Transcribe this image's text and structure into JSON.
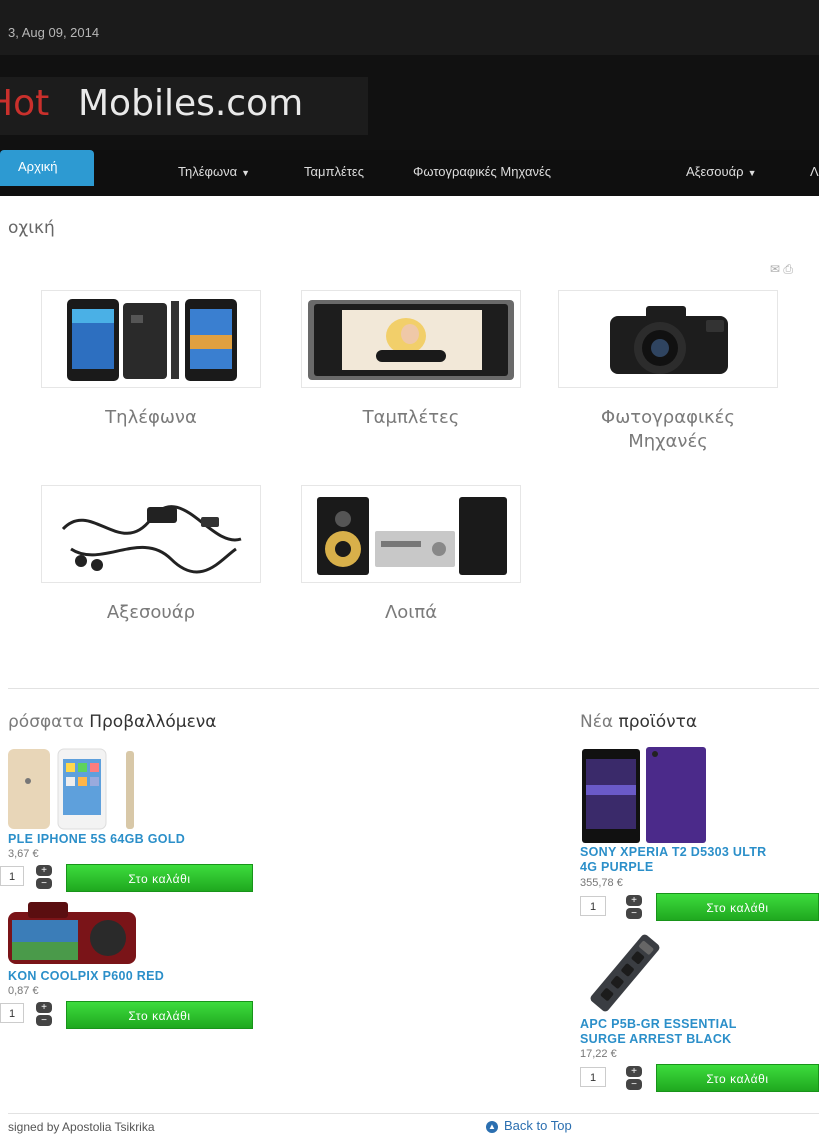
{
  "topbar": {
    "date": "3, Aug 09, 2014"
  },
  "logo": {
    "hot": "Hot",
    "main": "Mobiles.com"
  },
  "nav": [
    {
      "label": "Αρχική",
      "active": true
    },
    {
      "label": "Τηλέφωνα",
      "dropdown": true
    },
    {
      "label": "Ταμπλέτες"
    },
    {
      "label": "Φωτογραφικές Μηχανές"
    },
    {
      "label": "Αξεσουάρ",
      "dropdown": true
    },
    {
      "label": "Λ"
    }
  ],
  "breadcrumb": "οχική",
  "categories": [
    {
      "label": "Τηλέφωνα",
      "icon": "phones-image"
    },
    {
      "label": "Ταμπλέτες",
      "icon": "tablet-image"
    },
    {
      "label": "Φωτογραφικές Μηχανές",
      "label_line1": "Φωτογραφικές",
      "label_line2": "Μηχανές",
      "icon": "camera-image"
    },
    {
      "label": "Αξεσουάρ",
      "icon": "accessories-image"
    },
    {
      "label": "Λοιπά",
      "icon": "speakers-image"
    }
  ],
  "recent": {
    "title_a": "ρόσφατα",
    "title_b": "Προβαλλόμενα",
    "products": [
      {
        "name": "PLE IPHONE 5S 64GB GOLD",
        "price": "3,67 €",
        "qty": "1",
        "button": "Στο καλάθι"
      },
      {
        "name": "KON COOLPIX P600 RED",
        "price": "0,87 €",
        "qty": "1",
        "button": "Στο καλάθι"
      }
    ]
  },
  "new_products": {
    "title_a": "Νέα",
    "title_b": "προϊόντα",
    "products": [
      {
        "name_line1": "SONY XPERIA T2 D5303 ULTR",
        "name_line2": "4G PURPLE",
        "price": "355,78 €",
        "qty": "1",
        "button": "Στο καλάθι"
      },
      {
        "name_line1": "APC P5B-GR ESSENTIAL",
        "name_line2": "SURGE ARREST BLACK",
        "price": "17,22 €",
        "qty": "1",
        "button": "Στο καλάθι"
      }
    ]
  },
  "footer": {
    "credit": "signed by Apostolia Tsikrika",
    "back_to_top": "Back to Top"
  },
  "colors": {
    "accent": "#2d9ad2",
    "logo_red": "#c9302c",
    "cart_green": "#27c227",
    "link_blue": "#2b8fc9"
  }
}
